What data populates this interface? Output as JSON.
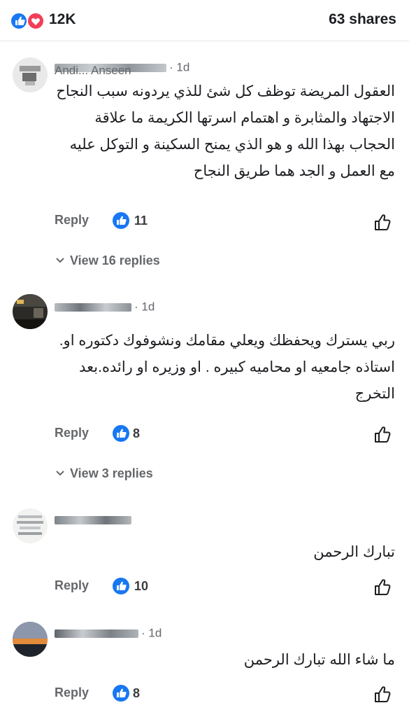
{
  "header": {
    "reaction_count": "12K",
    "shares": "63 shares",
    "reaction_icons": [
      "like-icon",
      "love-icon"
    ],
    "colors": {
      "like": "#1877f2",
      "love": "#f33e58"
    }
  },
  "comments": [
    {
      "author": "Andi... Anseen",
      "time": "· 1d",
      "lines": [
        "العقول المريضة توظف كل شئ  للذي يردونه سبب النجاح",
        "الاجتهاد والمثابرة  و اهتمام اسرتها الكريمة ما علاقة",
        "الحجاب بهذا الله و هو الذي يمنح السكينة و التوكل عليه",
        "مع العمل و الجد هما طريق النجاح"
      ],
      "reply_label": "Reply",
      "likes": "11",
      "view_replies": "View 16 replies"
    },
    {
      "author": "",
      "time": "· 1d",
      "lines": [
        "ربي يسترك ويحفظك ويعلي مقامك  ونشوفوك دكتوره او.",
        "استاذه جامعيه او محاميه كبيره .  او وزيره او رائده.بعد",
        "التخرج"
      ],
      "reply_label": "Reply",
      "likes": "8",
      "view_replies": "View 3 replies"
    },
    {
      "author": "",
      "time": "",
      "lines": [
        "تبارك الرحمن"
      ],
      "reply_label": "Reply",
      "likes": "10"
    },
    {
      "author": "",
      "time": "· 1d",
      "lines": [
        "ما شاء الله تبارك الرحمن"
      ],
      "reply_label": "Reply",
      "likes": "8"
    }
  ]
}
